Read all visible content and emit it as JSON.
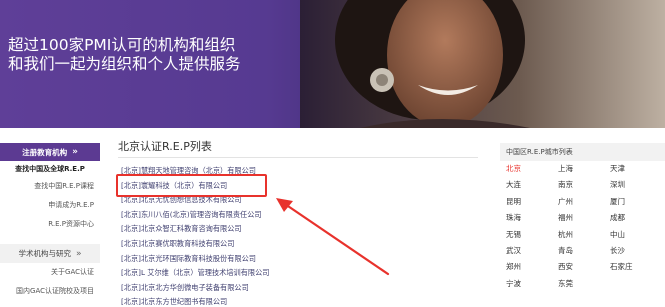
{
  "banner": {
    "line1": "超过100家PMI认可的机构和组织",
    "line2": "和我们一起为组织和个人提供服务"
  },
  "sidebar": {
    "register_label": "注册教育机构",
    "items": [
      "查找中国及全球R.E.P",
      "查找中国R.E.P课程",
      "申请成为R.E.P",
      "R.E.P资源中心"
    ],
    "academic_label": "学术机构与研究",
    "bottom_items": [
      "关于GAC认证",
      "国内GAC认证院校及项目"
    ]
  },
  "list": {
    "title": "北京认证R.E.P列表",
    "items": [
      "[北京]慧翔天地管理咨询（北京）有限公司",
      "[北京]寰耀科技（北京）有限公司",
      "[北京]北京无忧创想信息技术有限公司",
      "[北京]东川八佰(北京)管理咨询有限责任公司",
      "[北京]北京众智汇科教育咨询有限公司",
      "[北京]北京赛优职教育科技有限公司",
      "[北京]北京光环国际教育科技股份有限公司",
      "[北京]L 艾尔维（北京）管理技术培训有限公司",
      "[北京]北京北方华创微电子装备有限公司",
      "[北京]北京东方世纪图书有限公司"
    ]
  },
  "cities": {
    "header": "中国区R.E.P城市列表",
    "items": [
      "北京",
      "上海",
      "天津",
      "大连",
      "南京",
      "深圳",
      "昆明",
      "广州",
      "厦门",
      "珠海",
      "福州",
      "成都",
      "无锡",
      "杭州",
      "中山",
      "武汉",
      "青岛",
      "长沙",
      "郑州",
      "西安",
      "石家庄",
      "宁波",
      "东莞"
    ],
    "active": "北京",
    "active_color": "#e8322c"
  },
  "colors": {
    "brand_purple": "#5c3a92",
    "highlight_red": "#e8322c"
  }
}
